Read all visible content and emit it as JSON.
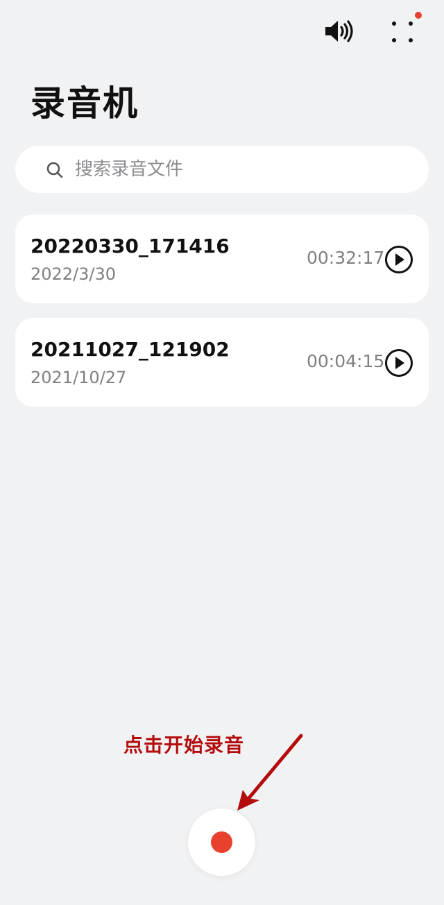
{
  "header": {
    "speaker_icon": "speaker-volume-icon",
    "more_icon": "more-dots-icon",
    "notification_dot_color": "#e8412d"
  },
  "page": {
    "title": "录音机"
  },
  "search": {
    "placeholder": "搜索录音文件",
    "icon": "search-icon"
  },
  "recordings": [
    {
      "name": "20220330_171416",
      "date": "2022/3/30",
      "duration": "00:32:17",
      "icon": "play-icon"
    },
    {
      "name": "20211027_121902",
      "date": "2021/10/27",
      "duration": "00:04:15",
      "icon": "play-icon"
    }
  ],
  "annotation": {
    "text": "点击开始录音",
    "color": "#b40c0c"
  },
  "record_button": {
    "icon": "record-dot-icon",
    "color": "#e8412d"
  }
}
